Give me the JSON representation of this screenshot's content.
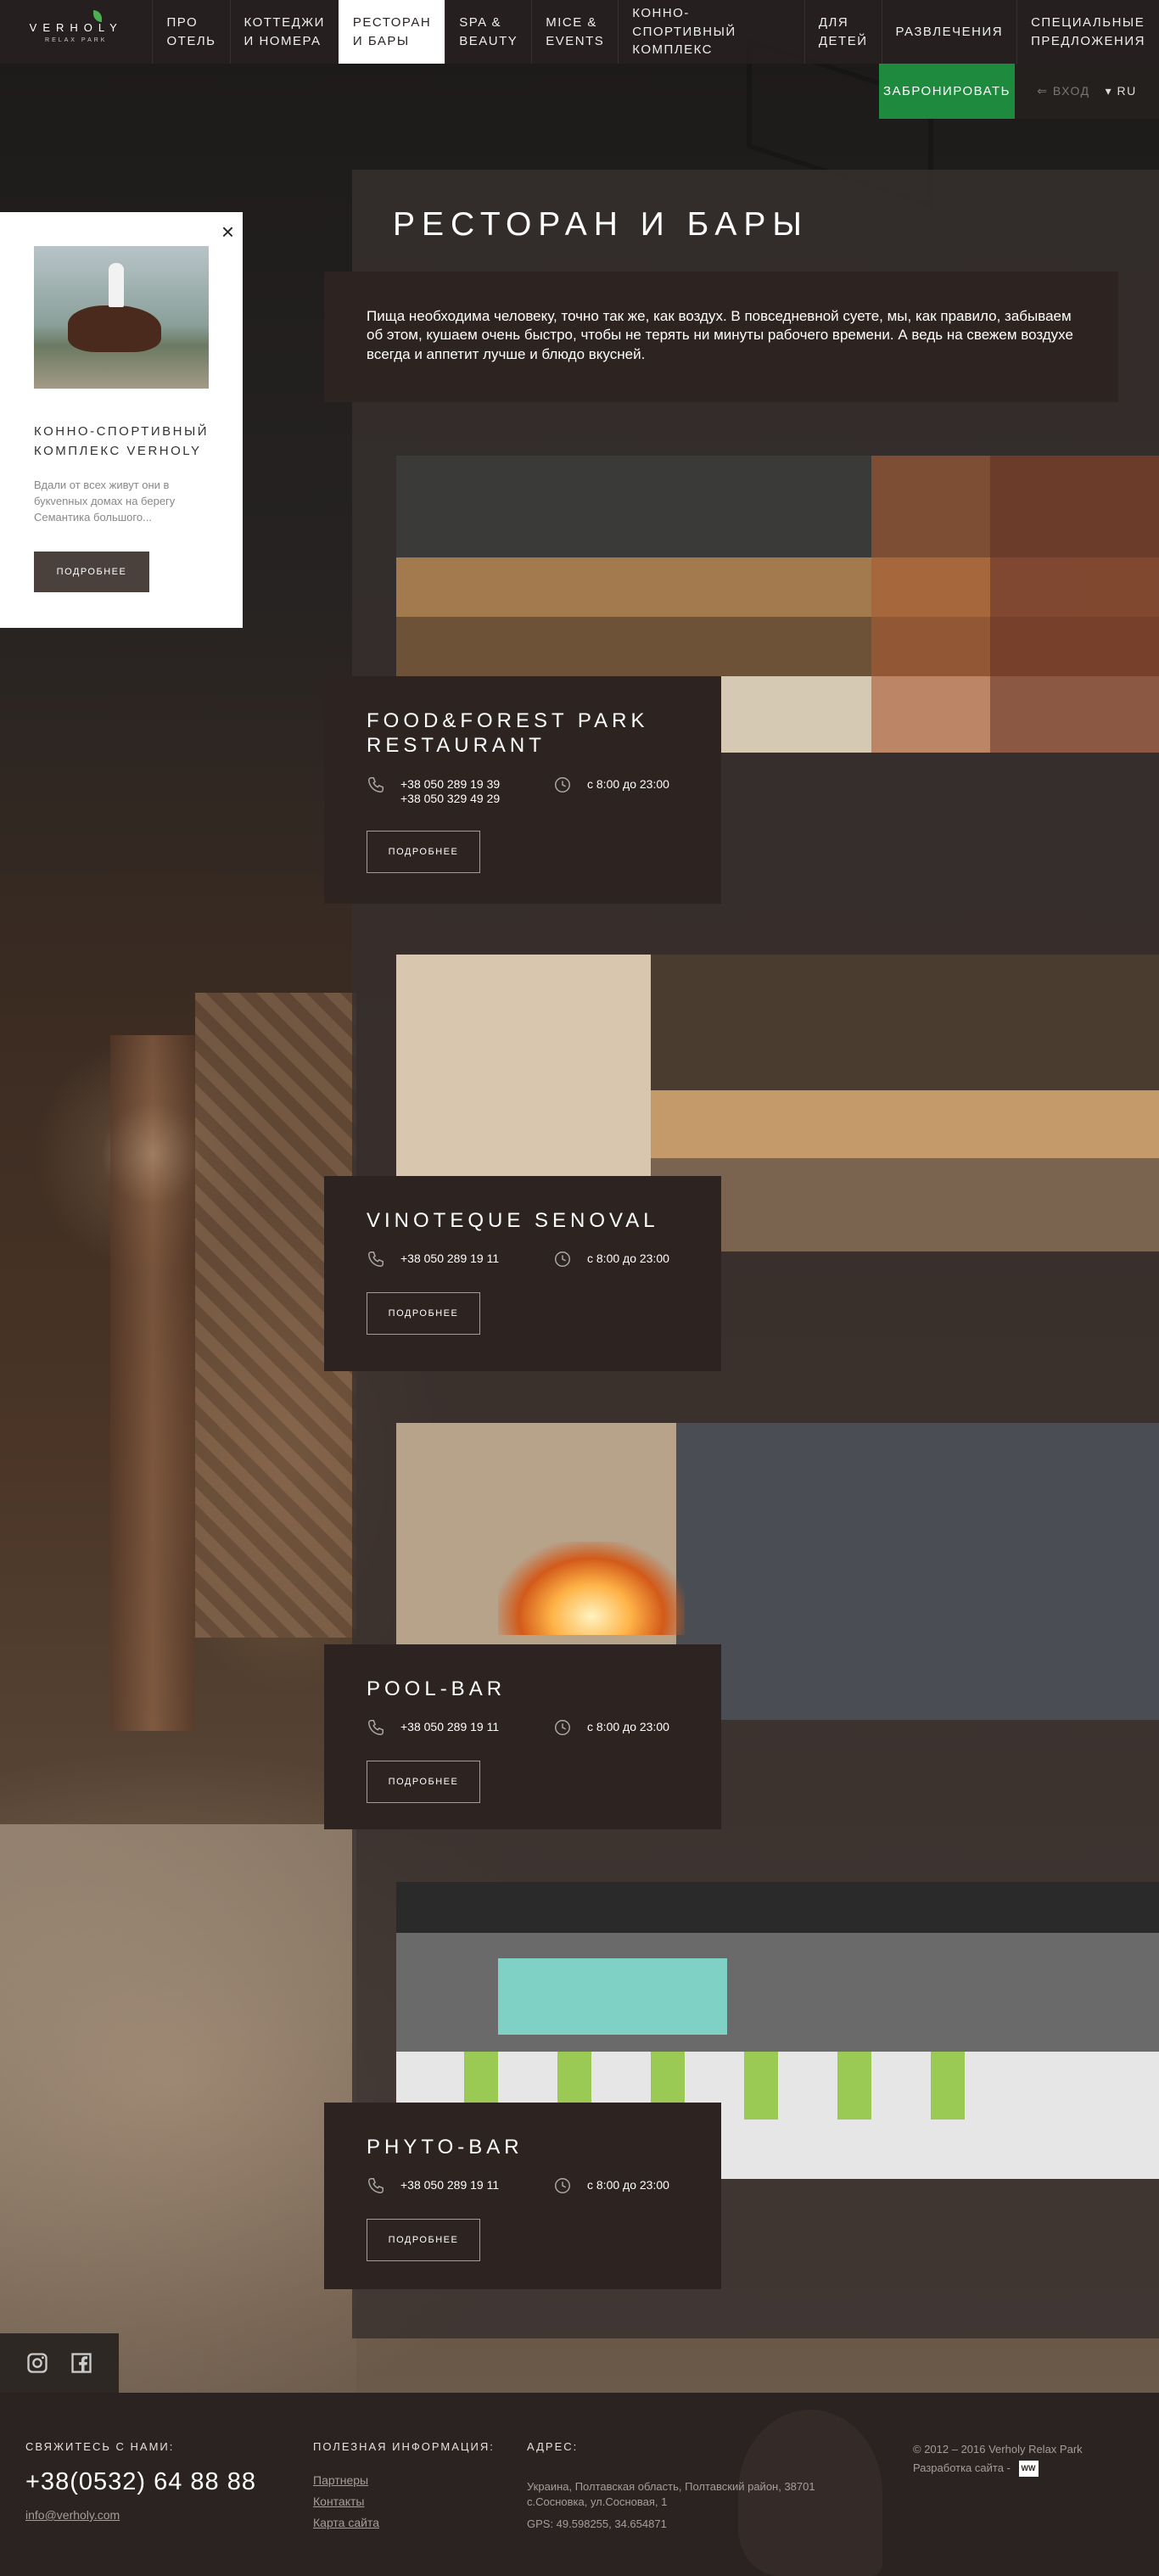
{
  "logo": {
    "name": "VERHOLY",
    "sub": "RELAX PARK"
  },
  "nav": [
    {
      "label": "ПРО\nОТЕЛЬ"
    },
    {
      "label": "КОТТЕДЖИ\nИ НОМЕРА"
    },
    {
      "label": "РЕСТОРАН\nИ БАРЫ",
      "active": true
    },
    {
      "label": "SPA &\nBEAUTY"
    },
    {
      "label": "MICE &\nEVENTS"
    },
    {
      "label": "КОННО-СПОРТИВНЫЙ\nКОМПЛЕКС"
    },
    {
      "label": "ДЛЯ\nДЕТЕЙ"
    },
    {
      "label": "РАЗВЛЕЧЕНИЯ"
    },
    {
      "label": "СПЕЦИАЛЬНЫЕ\nПРЕДЛОЖЕНИЯ"
    }
  ],
  "header": {
    "book_label": "ЗАБРОНИРОВАТЬ",
    "login_label": "ВХОД",
    "lang_label": "RU"
  },
  "promo": {
    "title": "КОННО-СПОРТИВНЫЙ КОМПЛЕКС VERHOLY",
    "text": "Вдали от всех живут они в букvenных домах на берегу Семантика большого...",
    "button": "ПОДРОБНЕЕ"
  },
  "page": {
    "title": "РЕСТОРАН И БАРЫ",
    "intro": "Пища необходима человеку, точно так же, как воздух. В повседневной суете, мы, как правило, забываем об этом, кушаем очень быстро, чтобы не терять ни минуты рабочего времени. А ведь на свежем воздухе всегда и аппетит лучше и блюдо вкусней."
  },
  "restaurants": [
    {
      "title": "FOOD&FOREST PARK RESTAURANT",
      "phone1": "+38 050 289 19 39",
      "phone2": "+38 050 329 49 29",
      "hours": "с 8:00 до 23:00",
      "button": "ПОДРОБНЕЕ"
    },
    {
      "title": "VINOTEQUE SENOVAL",
      "phone1": "+38 050 289 19 11",
      "phone2": "",
      "hours": "с 8:00 до 23:00",
      "button": "ПОДРОБНЕЕ"
    },
    {
      "title": "POOL-BAR",
      "phone1": "+38 050 289 19 11",
      "phone2": "",
      "hours": "с 8:00 до 23:00",
      "button": "ПОДРОБНЕЕ"
    },
    {
      "title": "PHYTO-BAR",
      "phone1": "+38 050 289 19 11",
      "phone2": "",
      "hours": "с 8:00 до 23:00",
      "button": "ПОДРОБНЕЕ"
    }
  ],
  "footer": {
    "contact_head": "СВЯЖИТЕСЬ С НАМИ:",
    "phone": "+38(0532) 64 88 88",
    "email": "info@verholy.com",
    "useful_head": "ПОЛЕЗНАЯ ИНФОРМАЦИЯ:",
    "links": [
      "Партнеры",
      "Контакты",
      "Карта сайта"
    ],
    "address_head": "АДРЕС:",
    "address": "Украина, Полтавская область, Полтавский район, 38701 с.Сосновка, ул.Сосновая, 1",
    "gps": "GPS: 49.598255, 34.654871",
    "copyright": "© 2012 – 2016  Verholy Relax Park",
    "developer": "Разработка сайта -",
    "dev_badge": "WW"
  },
  "colors": {
    "accent_green": "#1e8a3e",
    "panel_dark": "#2d2321",
    "active_nav_bg": "#ffffff"
  }
}
